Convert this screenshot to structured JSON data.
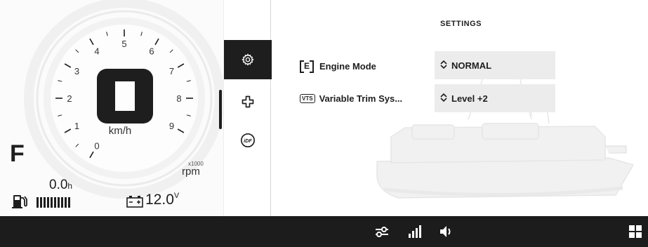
{
  "gauge": {
    "tick_labels": [
      "0",
      "1",
      "2",
      "3",
      "4",
      "5",
      "6",
      "7",
      "8",
      "9"
    ],
    "speed_value": 0,
    "speed_unit": "km/h",
    "rpm_multiplier": "x1000",
    "rpm_unit": "rpm"
  },
  "status": {
    "gear": "F",
    "hours_value": "0.0",
    "hours_unit": "h",
    "fuel_bars": 10,
    "voltage_value": "12.0",
    "voltage_unit": "V",
    "fuel_icon": "fuel-pump-icon",
    "battery_icon": "battery-icon"
  },
  "sidebar": {
    "items": [
      {
        "icon": "gear-icon",
        "active": true
      },
      {
        "icon": "plus-cross-icon",
        "active": false
      },
      {
        "icon": "idf-icon",
        "label": "iDF",
        "active": false
      }
    ]
  },
  "settings": {
    "title": "SETTINGS",
    "rows": [
      {
        "badge": "E",
        "label": "Engine Mode",
        "value": "NORMAL"
      },
      {
        "badge": "VTS",
        "label": "Variable Trim Sys...",
        "value": "Level +2"
      }
    ]
  },
  "bottom_bar": {
    "icons": [
      "trim-sliders-icon",
      "signal-bars-icon",
      "volume-icon",
      "grid-menu-icon"
    ]
  },
  "colors": {
    "dark": "#1e1e1e",
    "bar": "#1c1c1c",
    "select_bg": "#ececec"
  }
}
